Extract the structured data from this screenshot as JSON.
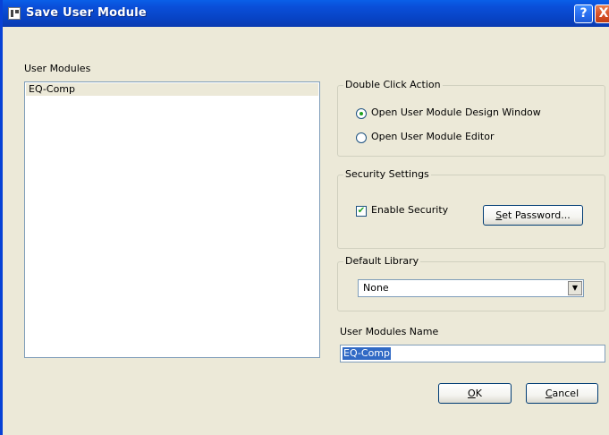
{
  "window": {
    "title": "Save User Module",
    "help_glyph": "?",
    "close_glyph": "X"
  },
  "user_modules": {
    "label": "User Modules",
    "items": [
      "EQ-Comp"
    ]
  },
  "double_click_action": {
    "legend": "Double Click Action",
    "options": [
      {
        "label": "Open User Module Design Window",
        "selected": true
      },
      {
        "label": "Open User Module Editor",
        "selected": false
      }
    ]
  },
  "security_settings": {
    "legend": "Security Settings",
    "enable_security_label": "Enable Security",
    "enable_security_checked": true,
    "set_password_mnemonic": "S",
    "set_password_rest": "et Password..."
  },
  "default_library": {
    "legend": "Default Library",
    "selected": "None"
  },
  "user_modules_name": {
    "label": "User Modules Name",
    "value": "EQ-Comp"
  },
  "buttons": {
    "ok_mnemonic": "O",
    "ok_rest": "K",
    "cancel_mnemonic": "C",
    "cancel_rest": "ancel"
  },
  "icons": {
    "app": "app-icon",
    "help": "help-icon",
    "close": "close-icon",
    "dropdown": "chevron-down-icon",
    "check": "check-icon"
  },
  "colors": {
    "titlebar": "#0a4fd9",
    "dialog_bg": "#ece9d8",
    "selection": "#316ac5"
  }
}
